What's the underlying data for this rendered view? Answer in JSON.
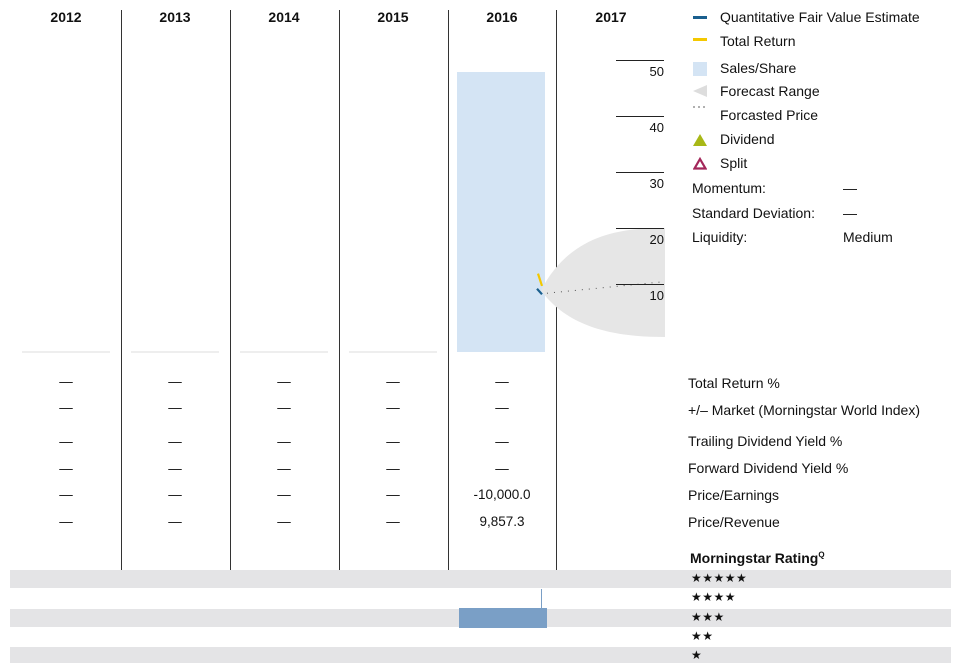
{
  "chart_data": [
    {
      "type": "bar",
      "categories": [
        "2012",
        "2013",
        "2014",
        "2015",
        "2016",
        "2017"
      ],
      "ylim": [
        0,
        55
      ],
      "yticks": [
        10,
        20,
        30,
        40,
        50
      ],
      "series": [
        {
          "name": "Sales/Share",
          "values": [
            null,
            null,
            null,
            null,
            50,
            null
          ],
          "color": "#d4e4f4"
        }
      ],
      "price_2016_end": 11,
      "forecast_range": {
        "low": 0,
        "high": 20,
        "color": "#e6e6e6"
      },
      "forecasted_price_line": {
        "from": 10.5,
        "to": 12.5
      },
      "total_return_color": "#f4c800",
      "fair_value_color": "#1a5f8e"
    },
    {
      "type": "table",
      "columns": [
        "2012",
        "2013",
        "2014",
        "2015",
        "2016"
      ],
      "rows": [
        {
          "label": "Total Return %",
          "values": [
            "—",
            "—",
            "—",
            "—",
            "—"
          ]
        },
        {
          "label": "+/– Market (Morningstar World Index)",
          "values": [
            "—",
            "—",
            "—",
            "—",
            "—"
          ]
        },
        {
          "label": "Trailing Dividend Yield %",
          "values": [
            "—",
            "—",
            "—",
            "—",
            "—"
          ]
        },
        {
          "label": "Forward Dividend Yield %",
          "values": [
            "—",
            "—",
            "—",
            "—",
            "—"
          ]
        },
        {
          "label": "Price/Earnings",
          "values": [
            "—",
            "—",
            "—",
            "—",
            "-10,000.0"
          ]
        },
        {
          "label": "Price/Revenue",
          "values": [
            "—",
            "—",
            "—",
            "—",
            "9,857.3"
          ]
        }
      ]
    },
    {
      "type": "bar",
      "title": "Morningstar Rating",
      "title_superscript": "Q",
      "rating_levels": [
        "★★★★★",
        "★★★★",
        "★★★",
        "★★",
        "★"
      ],
      "highlight": {
        "year": "2016",
        "rating": 3,
        "color": "#7a9fc6"
      }
    }
  ],
  "legend": {
    "items": [
      {
        "label": "Quantitative Fair Value Estimate",
        "symbol": "dash",
        "color": "#1a5f8e"
      },
      {
        "label": "Total Return",
        "symbol": "dash",
        "color": "#f4c800"
      },
      {
        "label": "Sales/Share",
        "symbol": "square",
        "color": "#d4e4f4"
      },
      {
        "label": "Forecast Range",
        "symbol": "wedge",
        "color": "#dddddd"
      },
      {
        "label": "Forcasted Price",
        "symbol": "dots",
        "color": "#888888"
      },
      {
        "label": "Dividend",
        "symbol": "triangle",
        "color": "#a8b817"
      },
      {
        "label": "Split",
        "symbol": "triangle-outline",
        "color": "#a3275a"
      }
    ],
    "stats": [
      {
        "label": "Momentum:",
        "value": "—"
      },
      {
        "label": "Standard Deviation:",
        "value": "—"
      },
      {
        "label": "Liquidity:",
        "value": "Medium"
      }
    ]
  }
}
